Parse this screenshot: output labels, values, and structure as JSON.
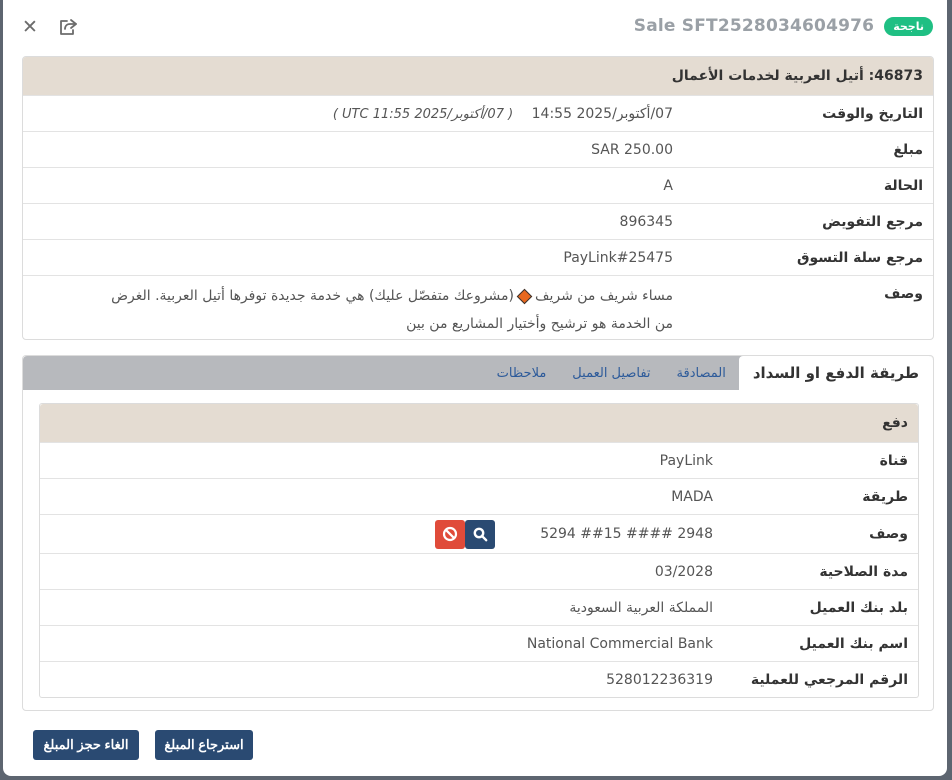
{
  "header": {
    "sale_title": "Sale  SFT2528034604976",
    "status_badge": "ناجحة"
  },
  "merchant": {
    "title": "46873: أتيل العربية لخدمات الأعمال",
    "rows": {
      "datetime_label": "التاريخ والوقت",
      "datetime_value": "07/أكتوبر/2025   14:55",
      "datetime_utc": "( 07/أكتوبر/2025 UTC 11:55 )",
      "amount_label": "مبلغ",
      "amount_value": "SAR 250.00",
      "status_label": "الحالة",
      "status_value": "A",
      "auth_label": "مرجع التفويض",
      "auth_value": "896345",
      "cart_label": "مرجع سلة التسوق",
      "cart_value": "PayLink#25475",
      "desc_label": "وصف",
      "desc_part1": "مساء شريف من شريف",
      "desc_part2": "(مشروعك متفصّل عليك) هي خدمة جديدة توفرها أتيل العربية. الغرض",
      "desc_line2": "من الخدمة هو ترشيح وأختيار المشاريع من بين"
    }
  },
  "tabs": [
    {
      "label": "طريقة الدفع او السداد"
    },
    {
      "label": "المصادقة"
    },
    {
      "label": "تفاصيل العميل"
    },
    {
      "label": "ملاحظات"
    }
  ],
  "payment": {
    "title": "دفع",
    "channel_label": "قناة",
    "channel_value": "PayLink",
    "method_label": "طريقة",
    "method_value": "MADA",
    "card_label": "وصف",
    "card_value": "5294 ##15 #### 2948",
    "expiry_label": "مدة الصلاحية",
    "expiry_value": "03/2028",
    "bank_country_label": "بلد بنك العميل",
    "bank_country_value": "المملكة العربية السعودية",
    "bank_name_label": "اسم بنك العميل",
    "bank_name_value": "National Commercial Bank",
    "ref_label": "الرقم المرجعي للعملية",
    "ref_value": "528012236319"
  },
  "footer": {
    "refund_label": "استرجاع المبلغ",
    "void_label": "الغاء حجز المبلغ"
  },
  "icons": {
    "close": "close-icon",
    "share": "share-icon",
    "search": "search-icon",
    "block": "ban-icon",
    "diamond": "diamond-icon"
  },
  "colors": {
    "badge": "#1fbf83",
    "section_header": "#e4dcd2",
    "primary_button": "#2a4a72",
    "danger_button": "#e04b3a",
    "tab_link": "#2c5a9a"
  }
}
